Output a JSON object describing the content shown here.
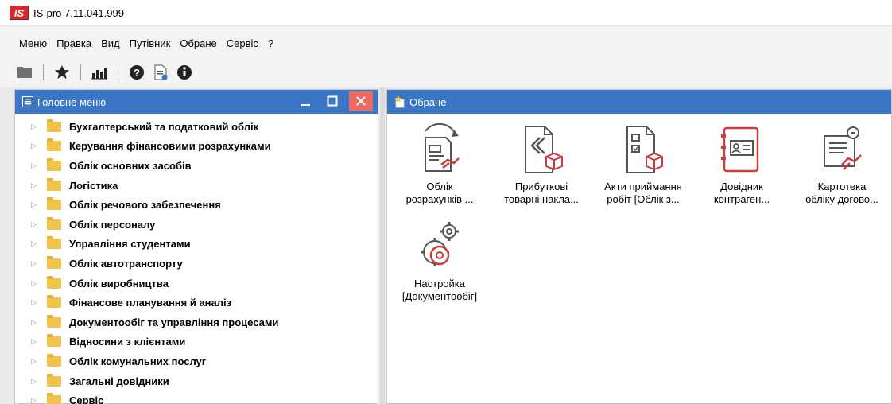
{
  "app": {
    "logo_text": "IS",
    "title": "IS-pro 7.11.041.999"
  },
  "menu": [
    "Меню",
    "Правка",
    "Вид",
    "Путівник",
    "Обране",
    "Сервіс",
    "?"
  ],
  "toolbar": {
    "icons": [
      "folder-icon",
      "star-icon",
      "chart-icon",
      "help-icon",
      "document-icon",
      "info-icon"
    ]
  },
  "left_panel": {
    "title": "Головне меню",
    "items": [
      "Бухгалтерський та податковий облік",
      "Керування фінансовими розрахунками",
      "Облік основних засобів",
      "Логістика",
      "Облік речового забезпечення",
      "Облік персоналу",
      "Управління студентами",
      "Облік автотранспорту",
      "Облік виробництва",
      "Фінансове планування й аналіз",
      "Документообіг та управління процесами",
      "Відносини з клієнтами",
      "Облік комунальних послуг",
      "Загальні довідники",
      "Сервіс"
    ]
  },
  "right_panel": {
    "title": "Обране",
    "favorites": [
      {
        "line1": "Облік",
        "line2": "розрахунків ..."
      },
      {
        "line1": "Прибуткові",
        "line2": "товарні накла..."
      },
      {
        "line1": "Акти приймання",
        "line2": "робіт [Облік з..."
      },
      {
        "line1": "Довідник",
        "line2": "контраген..."
      },
      {
        "line1": "Картотека",
        "line2": "обліку догово..."
      },
      {
        "line1": "Настройка",
        "line2": "[Документообіг]"
      }
    ]
  },
  "colors": {
    "header_blue": "#3a76c4",
    "close_red": "#ee6a5e",
    "logo_red": "#d22b2b",
    "icon_red": "#c83c3c",
    "icon_gray": "#555555"
  }
}
